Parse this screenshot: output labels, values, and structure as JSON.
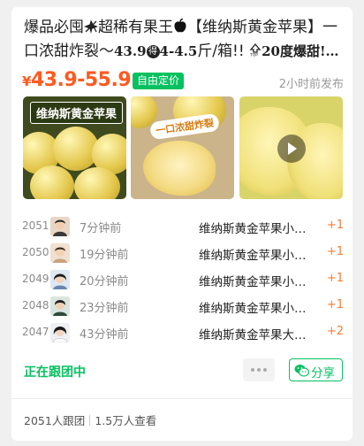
{
  "post": {
    "title_a": "爆品必囤",
    "title_b": "超稀有果王",
    "title_c": "【维纳斯黄金苹果】一口浓甜炸裂～",
    "title_d": "43.9",
    "title_circ": "得",
    "title_e": "4-4.5",
    "title_f": "斤/箱!! ",
    "title_g": "20度爆甜!…",
    "price_yen": "¥",
    "price": "43.9-55.9",
    "badge": "自由定价",
    "posted": "2小时前发布"
  },
  "images": {
    "img1_label": "维纳斯黄金苹果",
    "img2_label": "一口浓甜炸裂"
  },
  "orders": [
    {
      "num": "2051",
      "time": "7分钟前",
      "product": "维纳斯黄金苹果小…",
      "qty": "+1"
    },
    {
      "num": "2050",
      "time": "19分钟前",
      "product": "维纳斯黄金苹果小…",
      "qty": "+1"
    },
    {
      "num": "2049",
      "time": "20分钟前",
      "product": "维纳斯黄金苹果小…",
      "qty": "+1"
    },
    {
      "num": "2048",
      "time": "23分钟前",
      "product": "维纳斯黄金苹果小…",
      "qty": "+1"
    },
    {
      "num": "2047",
      "time": "43分钟前",
      "product": "维纳斯黄金苹果大…",
      "qty": "+2"
    }
  ],
  "actions": {
    "status": "正在跟团中",
    "share": "分享"
  },
  "footer": {
    "joined": "2051人跟团",
    "views": "1.5万人查看"
  },
  "colors": {
    "accent_green": "#07c160",
    "price_orange": "#ff5a1f",
    "qty_orange": "#ff7a2f"
  }
}
